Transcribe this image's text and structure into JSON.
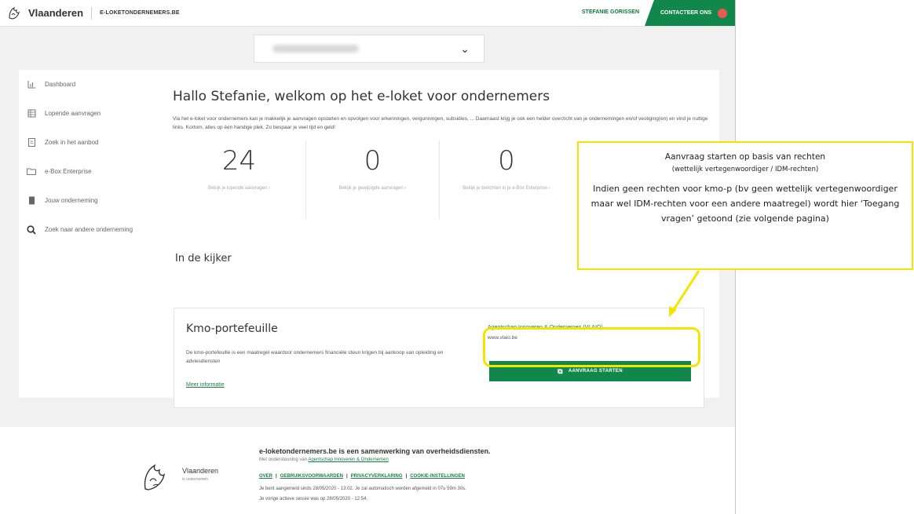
{
  "topbar": {
    "brand": "Vlaanderen",
    "subtitle": "E-LOKETONDERNEMERS.BE",
    "user": "STEFANIE GORISSEN",
    "contact": "CONTACTEER ONS"
  },
  "sidebar": {
    "items": [
      {
        "label": "Dashboard",
        "icon": "dashboard-icon"
      },
      {
        "label": "Lopende aanvragen",
        "icon": "list-icon"
      },
      {
        "label": "Zoek in het aanbod",
        "icon": "catalog-icon"
      },
      {
        "label": "e-Box Enterprise",
        "icon": "folder-icon"
      },
      {
        "label": "Jouw onderneming",
        "icon": "building-icon"
      },
      {
        "label": "Zoek naar andere onderneming",
        "icon": "search-icon"
      }
    ]
  },
  "main": {
    "title": "Hallo Stefanie, welkom op het e-loket voor ondernemers",
    "intro": "Via het e-loket voor ondernemers kan je makkelijk je aanvragen opstarten en opvolgen voor erkenningen, vergunningen, subsidies, ... Daarnaast krijg je ook een helder overzicht van je ondernemingen en/of vestiging(en) en vind je nuttige links. Kortom, alles op één handige plek. Zo bespaar je veel tijd en geld!",
    "stats": [
      {
        "value": "24",
        "link": "Bekijk je lopende aanvragen ›"
      },
      {
        "value": "0",
        "link": "Bekijk je gewijzigde aanvragen ›"
      },
      {
        "value": "0",
        "link": "Bekijk je berichten in je e-Box Enterprise ›"
      }
    ],
    "section": "In de kijker",
    "card": {
      "title": "Kmo-portefeuille",
      "description": "De kmo-portefeuille is een maatregel waardoor ondernemers financiële steun krijgen bij aankoop van opleiding en adviesdiensten",
      "more": "Meer informatie",
      "agency": "Agentschap Innoveren & Ondernemen (VLAIO)",
      "url": "www.vlaio.be",
      "button": "AANVRAAG STARTEN"
    }
  },
  "callout": {
    "line1": "Aanvraag starten op basis van rechten",
    "line2": "(wettelijk vertegenwoordiger / IDM-rechten)",
    "line3": "Indien geen rechten voor kmo-p (bv geen wettelijk vertegenwoordiger maar wel IDM-rechten voor een andere maatregel) wordt hier ‘Toegang vragen’ getoond (zie volgende pagina)"
  },
  "footer": {
    "brand": "Vlaanderen",
    "brand_sub": "is ondernemen",
    "title": "e-loketondernemers.be is een samenwerking van overheidsdiensten.",
    "support_prefix": "Met ondersteuning van ",
    "support_link": "Agentschap Innoveren & Ondernemen",
    "links": [
      "OVER",
      "GEBRUIKSVOORWAARDEN",
      "PRIVACYVERKLARING",
      "COOKIE-INSTELLINGEN"
    ],
    "session": "Je bent aangemeld sinds 28/05/2020 - 13:02. Je zal automatisch worden afgemeld in 07u 59m 30s.",
    "previous": "Je vorige actieve sessie was op 28/05/2020 - 12:54."
  },
  "colors": {
    "accent": "#12874c",
    "highlight": "#f6e400"
  }
}
